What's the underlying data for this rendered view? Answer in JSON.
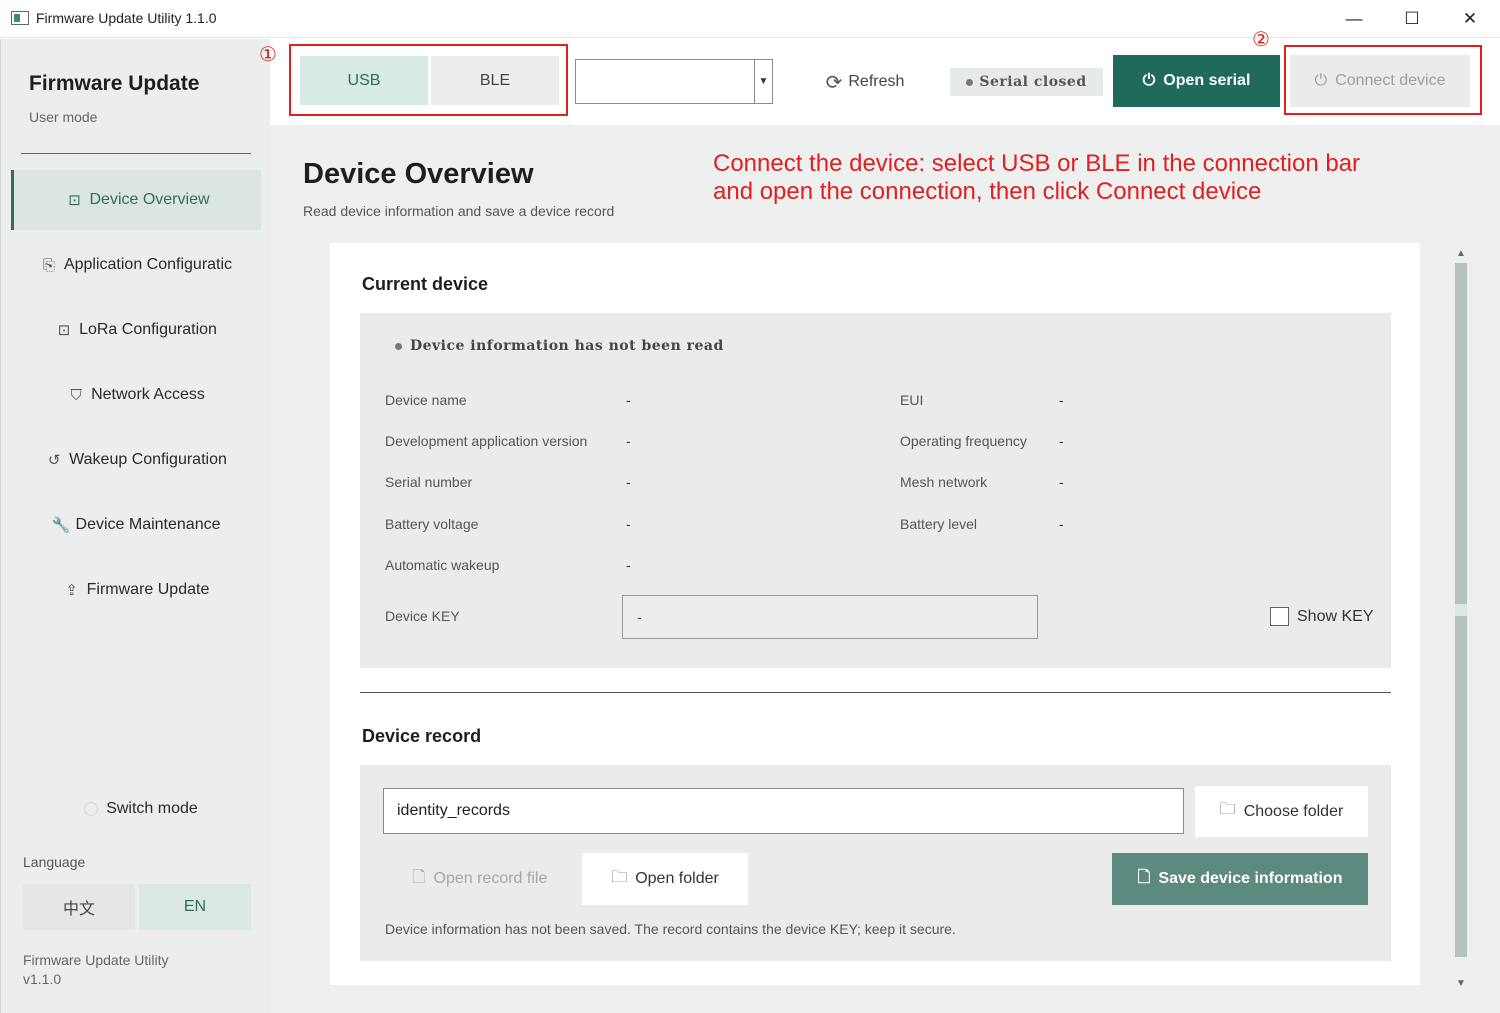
{
  "window": {
    "title": "Firmware Update Utility 1.1.0",
    "minimize": "—",
    "maximize": "☐",
    "close": "✕"
  },
  "sidebar": {
    "brand_title": "Firmware Update",
    "brand_subtitle": "User mode",
    "items": [
      {
        "label": "Device Overview",
        "icon": "⊡",
        "active": true
      },
      {
        "label": "Application Configuratic",
        "icon": "⎘",
        "active": false
      },
      {
        "label": "LoRa Configuration",
        "icon": "⊡",
        "active": false
      },
      {
        "label": "Network Access",
        "icon": "⛉",
        "active": false
      },
      {
        "label": "Wakeup Configuration",
        "icon": "↺",
        "active": false
      },
      {
        "label": "Device Maintenance",
        "icon": "🔧",
        "active": false
      },
      {
        "label": "Firmware Update",
        "icon": "⇪",
        "active": false
      }
    ],
    "switch_mode": "Switch mode",
    "language_label": "Language",
    "languages": [
      "中文",
      "EN"
    ],
    "footer_name": "Firmware Update Utility",
    "footer_version": "v1.1.0"
  },
  "connection_bar": {
    "modes": [
      "USB",
      "BLE"
    ],
    "selected_mode": "USB",
    "port_value": "",
    "refresh_label": "Refresh",
    "refresh_icon": "⟳",
    "serial_status": "Serial closed",
    "open_serial_label": "Open serial",
    "open_serial_icon": "⏻",
    "connect_device_label": "Connect device",
    "connect_device_icon": "⏻"
  },
  "annotations": {
    "step1": "①",
    "step2": "②",
    "instruction": "Connect the device: select USB or BLE in the connection bar and open the connection, then click Connect device",
    "color": "#e02020"
  },
  "page": {
    "title": "Device Overview",
    "subtitle": "Read device information and save a device record"
  },
  "current_device": {
    "section_title": "Current device",
    "status": "Device information has not been read",
    "left_fields": [
      {
        "label": "Device name",
        "value": "-"
      },
      {
        "label": "Development application version",
        "value": "-"
      },
      {
        "label": "Serial number",
        "value": "-"
      },
      {
        "label": "Battery voltage",
        "value": "-"
      },
      {
        "label": "Automatic wakeup",
        "value": "-"
      }
    ],
    "right_fields": [
      {
        "label": "EUI",
        "value": "-"
      },
      {
        "label": "Operating frequency",
        "value": "-"
      },
      {
        "label": "Mesh network",
        "value": "-"
      },
      {
        "label": "Battery level",
        "value": "-"
      }
    ],
    "key_label": "Device KEY",
    "key_value": "-",
    "show_key_label": "Show KEY",
    "show_key_checked": false
  },
  "device_record": {
    "section_title": "Device record",
    "folder_value": "identity_records",
    "choose_folder_label": "Choose folder",
    "open_record_label": "Open record file",
    "open_folder_label": "Open folder",
    "save_label": "Save device information",
    "note": "Device information has not been saved. The record contains the device KEY; keep it secure."
  },
  "colors": {
    "accent": "#1f6a5a",
    "sidebar_bg": "#ebeeec",
    "active_bg": "#dbe6e1"
  }
}
